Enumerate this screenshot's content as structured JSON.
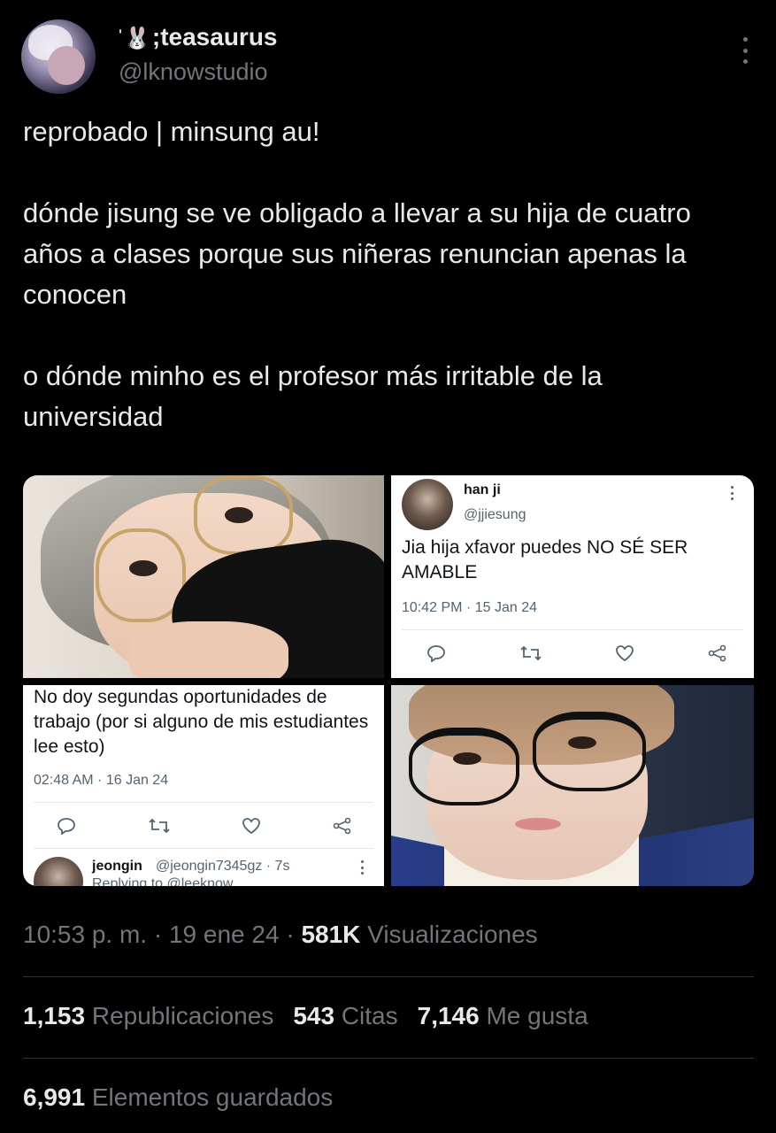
{
  "author": {
    "display_name": ";teasaurus",
    "emoji_prefix": "ˈ🐰",
    "handle": "@lknowstudio"
  },
  "tweet": {
    "paragraphs": [
      "reprobado | minsung au!",
      "dónde jisung se ve obligado a llevar a su hija de cuatro años a clases porque sus niñeras renuncian apenas la conocen",
      "o dónde minho es el profesor más irritable de la universidad"
    ]
  },
  "media": {
    "card_top": {
      "name": "han ji",
      "handle": "@jjiesung",
      "text": "Jia hija xfavor puedes NO SÉ SER AMABLE",
      "time": "10:42 PM · 15 Jan 24"
    },
    "card_bottom": {
      "text": "No doy segundas oportunidades de trabajo (por si alguno de mis estudiantes lee esto)",
      "time": "02:48 AM · 16 Jan 24",
      "reply_name": "jeongin",
      "reply_handle": "@jeongin7345gz · 7s",
      "reply_note": "Replying to @leeknow"
    }
  },
  "meta": {
    "time": "10:53 p. m.",
    "sep1": " · ",
    "date": "19 ene 24",
    "sep2": " · ",
    "views_count": "581K",
    "views_label": " Visualizaciones"
  },
  "stats": {
    "reposts_count": "1,153",
    "reposts_label": " Republicaciones",
    "quotes_count": "543",
    "quotes_label": " Citas",
    "likes_count": "7,146",
    "likes_label": " Me gusta",
    "bookmarks_count": "6,991",
    "bookmarks_label": " Elementos guardados"
  },
  "colors": {
    "background": "#000000",
    "text": "#e7e9ea",
    "muted": "#71767b",
    "divider": "#2f3336"
  }
}
